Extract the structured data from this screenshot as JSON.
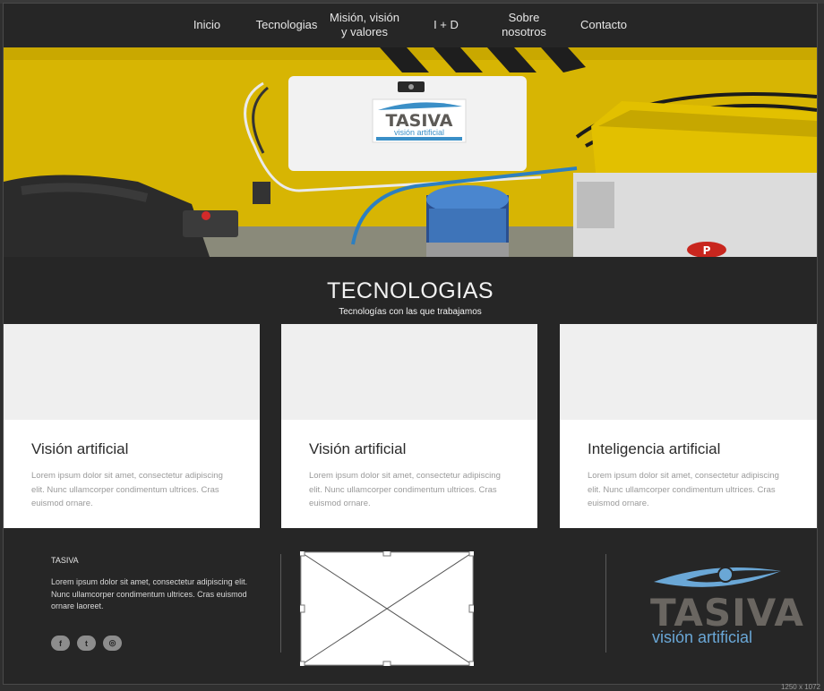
{
  "nav": {
    "items": [
      {
        "label": "Inicio"
      },
      {
        "label": "Tecnologias"
      },
      {
        "label": "Misión, visión\ny valores"
      },
      {
        "label": "I + D"
      },
      {
        "label": "Sobre\nnosotros"
      },
      {
        "label": "Contacto"
      }
    ]
  },
  "hero": {
    "panel_logo": "TASIVA",
    "panel_sub": "visión artificial",
    "badge": "P"
  },
  "technologies": {
    "title": "TECNOLOGIAS",
    "subtitle": "Tecnologías con las que trabajamos",
    "cards": [
      {
        "title": "Visión artificial",
        "text": "Lorem ipsum dolor sit amet, consectetur adipiscing elit. Nunc ullamcorper condimentum ultrices. Cras euismod ornare."
      },
      {
        "title": "Visión artificial",
        "text": "Lorem ipsum dolor sit amet, consectetur adipiscing elit. Nunc ullamcorper condimentum ultrices. Cras euismod ornare."
      },
      {
        "title": "Inteligencia artificial",
        "text": "Lorem ipsum dolor sit amet, consectetur adipiscing elit. Nunc ullamcorper condimentum ultrices. Cras euismod ornare."
      }
    ]
  },
  "footer": {
    "brand": "TASIVA",
    "text": "Lorem ipsum dolor sit amet, consectetur adipiscing elit. Nunc ullamcorper condimentum ultrices. Cras euismod ornare laoreet.",
    "social": [
      {
        "icon": "facebook-icon",
        "glyph": "f"
      },
      {
        "icon": "twitter-icon",
        "glyph": "t"
      },
      {
        "icon": "dribbble-icon",
        "glyph": "◎"
      }
    ],
    "logo": {
      "word": "TASIVA",
      "sub": "visión artificial"
    }
  },
  "canvas_size_label": "1250 x 1072",
  "colors": {
    "background": "#262626",
    "accent_blue": "#6aa7d6",
    "logo_gray": "#6a6661",
    "hero_yellow": "#d6b400"
  }
}
